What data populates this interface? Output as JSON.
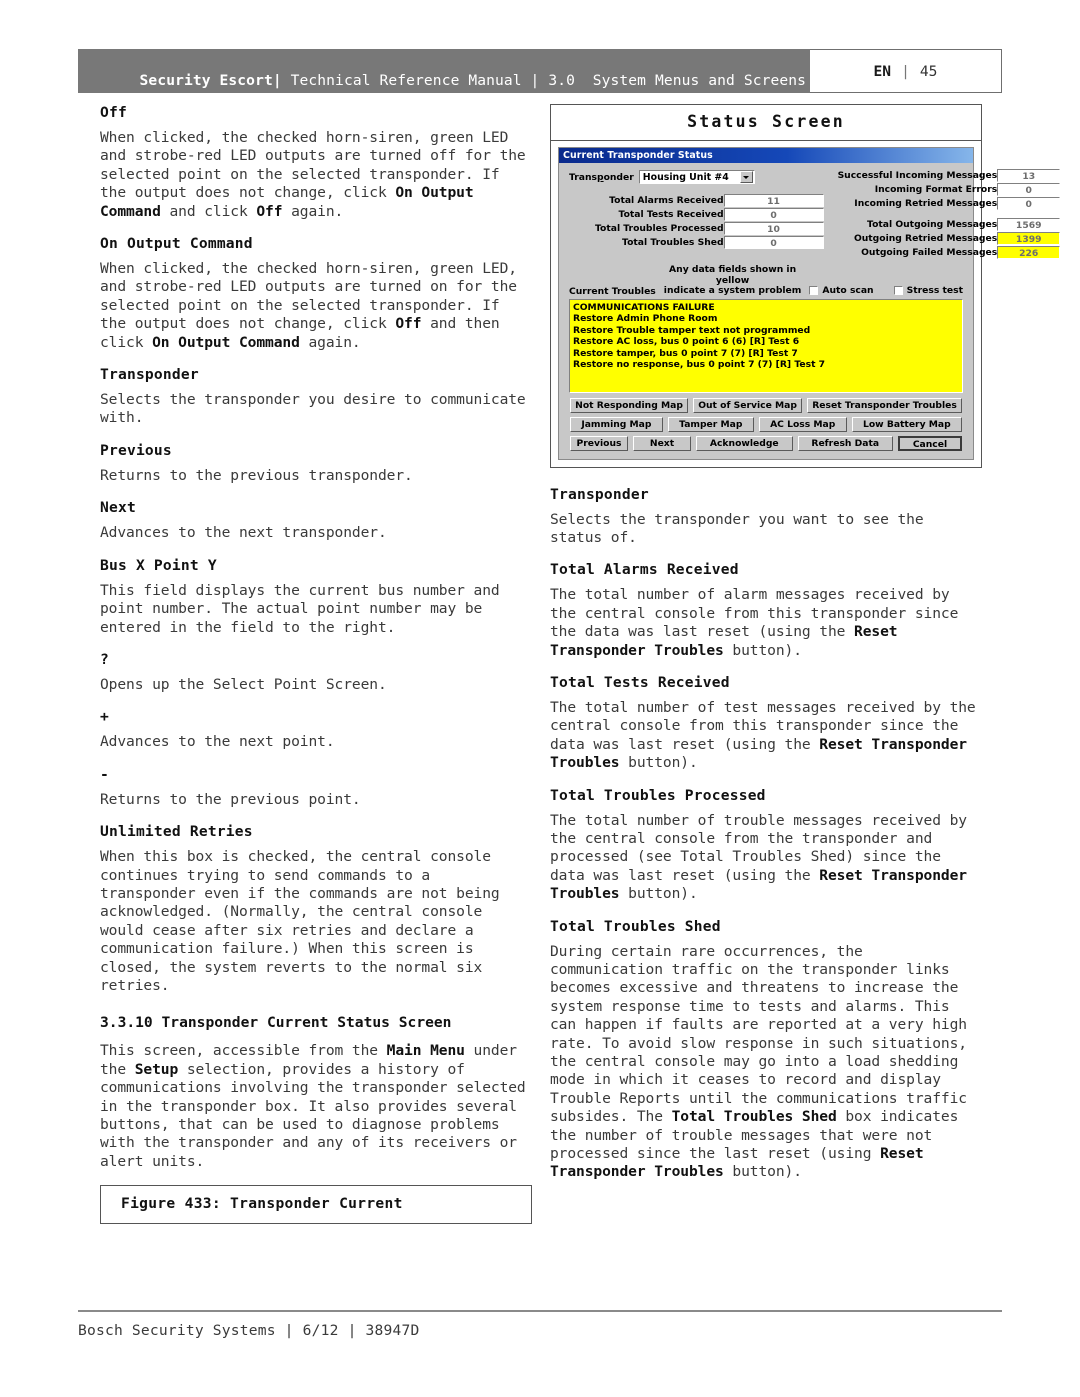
{
  "header": {
    "brand": "Security Escort",
    "sep": "|",
    "subtitle": "Technical Reference Manual | 3.0  System Menus and Screens",
    "lang": "EN",
    "lang_sep": "|",
    "page_number": "45"
  },
  "footer": {
    "text": "Bosch Security Systems | 6/12 | 38947D"
  },
  "left_column": {
    "blocks": [
      {
        "term": "Off",
        "body": "When clicked, the checked horn-siren, green LED and strobe-red LED outputs are turned off for the selected point on the selected transponder. If the output does not change, click "
      },
      {
        "term": "On Output Command",
        "body": "When clicked, the checked horn-siren, green LED, and strobe-red LED outputs are turned on for the selected point on the selected transponder. If the output does not change, click "
      },
      {
        "term": "Transponder",
        "body": "Selects the transponder you desire to communicate with."
      },
      {
        "term": "Previous",
        "body": "Returns to the previous transponder."
      },
      {
        "term": "Next",
        "body": "Advances to the next transponder."
      },
      {
        "term": "Bus X Point Y",
        "body": "This field displays the current bus number and point number. The actual point number may be entered in the field to the right."
      },
      {
        "term": "?",
        "body": "Opens up the Select Point Screen."
      },
      {
        "term": "+",
        "body": "Advances to the next point."
      },
      {
        "term": "-",
        "body": "Returns to the previous point."
      },
      {
        "term": "Unlimited Retries",
        "body": "When this box is checked, the central console continues trying to send commands to a transponder even if the commands are not being acknowledged. (Normally, the central console would cease after six retries and declare a communication failure.) When this screen is closed, the system reverts to the normal six retries."
      }
    ],
    "inline": {
      "off_bold_1": "On Output Command",
      "off_mid": " and click ",
      "off_bold_2": "Off",
      "off_tail": " again.",
      "on_bold_1": "Off",
      "on_mid": " and then click ",
      "on_bold_2": "On Output Command",
      "on_tail": " again."
    },
    "section": {
      "number": "3.3.10",
      "title": "Transponder Current Status Screen",
      "intro_1": "This screen, accessible from the ",
      "intro_b1": "Main Menu",
      "intro_2": " under the ",
      "intro_b2": "Setup",
      "intro_3": " selection, provides a history of communications involving the transponder selected in the transponder box. It also provides several buttons, that can be used to diagnose problems with the transponder and any of its receivers or alert units."
    },
    "caption": "Figure 433: Transponder Current"
  },
  "figure": {
    "title": "Status Screen",
    "dialog": {
      "title": "Current Transponder Status",
      "transponder_label": "Transponder",
      "transponder_value": "Housing Unit #4",
      "left_fields": [
        {
          "label": "Total Alarms Received",
          "value": "11",
          "highlight": false
        },
        {
          "label": "Total Tests Received",
          "value": "0",
          "highlight": false
        },
        {
          "label": "Total Troubles Processed",
          "value": "10",
          "highlight": false
        },
        {
          "label": "Total Troubles Shed",
          "value": "0",
          "highlight": false
        }
      ],
      "right_fields_group1": [
        {
          "label": "Successful Incoming Messages",
          "value": "13",
          "highlight": false
        },
        {
          "label": "Incoming Format Errors",
          "value": "0",
          "highlight": false
        },
        {
          "label": "Incoming Retried Messages",
          "value": "0",
          "highlight": false
        }
      ],
      "right_fields_group2": [
        {
          "label": "Total Outgoing Messages",
          "value": "1569",
          "highlight": false
        },
        {
          "label": "Outgoing Retried Messages",
          "value": "1399",
          "highlight": true
        },
        {
          "label": "Outgoing Failed Messages",
          "value": "226",
          "highlight": true
        }
      ],
      "current_troubles_label": "Current Troubles",
      "yellow_note_line1": "Any data fields shown in yellow",
      "yellow_note_line2": "indicate a system problem",
      "checkboxes": [
        {
          "label": "Auto scan",
          "checked": false
        },
        {
          "label": "Stress test",
          "checked": false
        }
      ],
      "trouble_messages": [
        "COMMUNICATIONS FAILURE",
        "Restore Admin Phone Room",
        "Restore Trouble tamper text not programmed",
        "Restore AC loss, bus 0 point 6 (6) [R] Test 6",
        "Restore tamper, bus 0 point 7 (7) [R] Test 7",
        "Restore no response, bus 0 point 7 (7) [R] Test 7"
      ],
      "buttons_row1": [
        "Not Responding Map",
        "Out of Service Map",
        "Reset Transponder Troubles"
      ],
      "buttons_row2": [
        "Jamming Map",
        "Tamper Map",
        "AC Loss Map",
        "Low Battery Map"
      ],
      "buttons_row3": [
        "Previous",
        "Next",
        "Acknowledge",
        "Refresh Data",
        "Cancel"
      ]
    },
    "colors": {
      "highlight_yellow": "#ffff00",
      "titlebar_blue": "#0a2a8c",
      "dialog_face": "#c8c8c8"
    }
  },
  "right_column": {
    "blocks": [
      {
        "term": "Transponder",
        "body": "Selects the transponder you want to see the status of."
      },
      {
        "term": "Total Alarms Received",
        "b1": "The total number of alarm messages received by the central console from this transponder since the data was last reset (using the ",
        "bold": "Reset Transponder Troubles",
        "b2": " button)."
      },
      {
        "term": "Total Tests Received",
        "b1": "The total number of test messages received by the central console from this transponder since the data was last reset (using the ",
        "bold": "Reset Transponder Troubles",
        "b2": " button)."
      },
      {
        "term": "Total Troubles Processed",
        "b1": "The total number of trouble messages received by the central console from the transponder and processed (see Total Troubles Shed) since the data was last reset (using the ",
        "bold": "Reset Transponder Troubles",
        "b2": " button)."
      },
      {
        "term": "Total Troubles Shed",
        "b1": "During certain rare occurrences, the communication traffic on the transponder links becomes excessive and threatens to increase the system response time to tests and alarms. This can happen if faults are reported at a very high rate. To avoid slow response in such situations, the central console may go into a load shedding mode in which it ceases to record and display Trouble Reports until the communications traffic subsides. The ",
        "bold": "Total Troubles Shed",
        "b2": " box indicates the number of trouble messages that were not processed since the last reset (using ",
        "bold2": "Reset Transponder Troubles",
        "b3": " button)."
      }
    ]
  }
}
